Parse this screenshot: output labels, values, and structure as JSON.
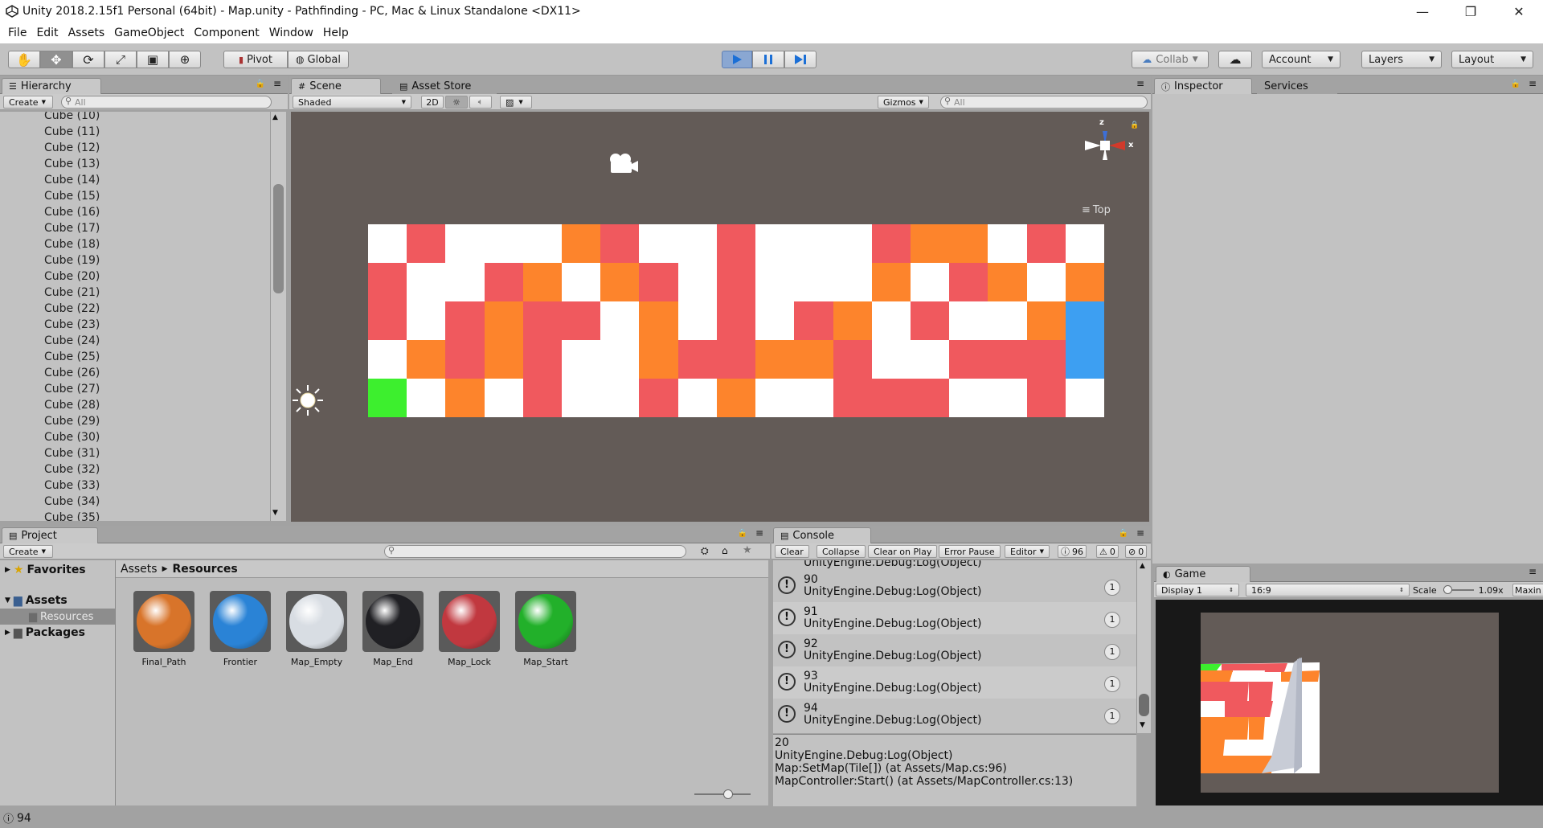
{
  "window": {
    "title": "Unity 2018.2.15f1 Personal (64bit) - Map.unity - Pathfinding - PC, Mac & Linux Standalone <DX11>",
    "controls": [
      "—",
      "❐",
      "✕"
    ]
  },
  "menu": [
    "File",
    "Edit",
    "Assets",
    "GameObject",
    "Component",
    "Window",
    "Help"
  ],
  "toolbar": {
    "pivot": "Pivot",
    "global": "Global",
    "collab": "Collab",
    "account": "Account",
    "layers": "Layers",
    "layout": "Layout"
  },
  "hierarchy": {
    "tab": "Hierarchy",
    "create": "Create",
    "search_placeholder": "All",
    "items": [
      "Cube (10)",
      "Cube (11)",
      "Cube (12)",
      "Cube (13)",
      "Cube (14)",
      "Cube (15)",
      "Cube (16)",
      "Cube (17)",
      "Cube (18)",
      "Cube (19)",
      "Cube (20)",
      "Cube (21)",
      "Cube (22)",
      "Cube (23)",
      "Cube (24)",
      "Cube (25)",
      "Cube (26)",
      "Cube (27)",
      "Cube (28)",
      "Cube (29)",
      "Cube (30)",
      "Cube (31)",
      "Cube (32)",
      "Cube (33)",
      "Cube (34)",
      "Cube (35)"
    ]
  },
  "scene": {
    "tab_scene": "Scene",
    "tab_asset_store": "Asset Store",
    "shading": "Shaded",
    "mode_2d": "2D",
    "gizmos": "Gizmos",
    "search_placeholder": "All",
    "view_label": "Top",
    "axis_x": "x",
    "axis_z": "z",
    "colors": {
      "W": "#ffffff",
      "R": "#f0595e",
      "O": "#fd842c",
      "B": "#3d9ff2",
      "G": "#3def2e"
    },
    "grid": [
      "WRWWWORWWRWWWROOWRW",
      "RWWROWORWRWWWOWROWO",
      "RWRORRWOWRWROWRWWOB",
      "WORORWWORROORWWRRRB",
      "GWOWRWWRWOWWRRRWWRW"
    ]
  },
  "inspector": {
    "tab_inspector": "Inspector",
    "tab_services": "Services"
  },
  "project": {
    "tab": "Project",
    "create": "Create",
    "favorites": "Favorites",
    "assets": "Assets",
    "resources": "Resources",
    "packages": "Packages",
    "breadcrumb": [
      "Assets",
      "Resources"
    ],
    "items": [
      {
        "name": "Final_Path",
        "color": "#d8742a"
      },
      {
        "name": "Frontier",
        "color": "#2a83d6"
      },
      {
        "name": "Map_Empty",
        "color": "#d8dde3"
      },
      {
        "name": "Map_End",
        "color": "#202024"
      },
      {
        "name": "Map_Lock",
        "color": "#c1383f"
      },
      {
        "name": "Map_Start",
        "color": "#22b02a"
      }
    ]
  },
  "console": {
    "tab": "Console",
    "clear": "Clear",
    "collapse": "Collapse",
    "clear_on_play": "Clear on Play",
    "error_pause": "Error Pause",
    "editor": "Editor",
    "count_info": "96",
    "count_warn": "0",
    "count_err": "0",
    "partial_row": "UnityEngine.Debug:Log(Object)",
    "rows": [
      {
        "num": "90",
        "text": "UnityEngine.Debug:Log(Object)",
        "count": "1"
      },
      {
        "num": "91",
        "text": "UnityEngine.Debug:Log(Object)",
        "count": "1"
      },
      {
        "num": "92",
        "text": "UnityEngine.Debug:Log(Object)",
        "count": "1"
      },
      {
        "num": "93",
        "text": "UnityEngine.Debug:Log(Object)",
        "count": "1"
      },
      {
        "num": "94",
        "text": "UnityEngine.Debug:Log(Object)",
        "count": "1"
      }
    ],
    "detail": [
      "20",
      "UnityEngine.Debug:Log(Object)",
      "Map:SetMap(Tile[]) (at Assets/Map.cs:96)",
      "MapController:Start() (at Assets/MapController.cs:13)"
    ]
  },
  "game": {
    "tab": "Game",
    "display": "Display 1",
    "aspect": "16:9",
    "scale_label": "Scale",
    "scale_value": "1.09x",
    "maximize": "Maxin"
  },
  "status": {
    "text": "94"
  }
}
